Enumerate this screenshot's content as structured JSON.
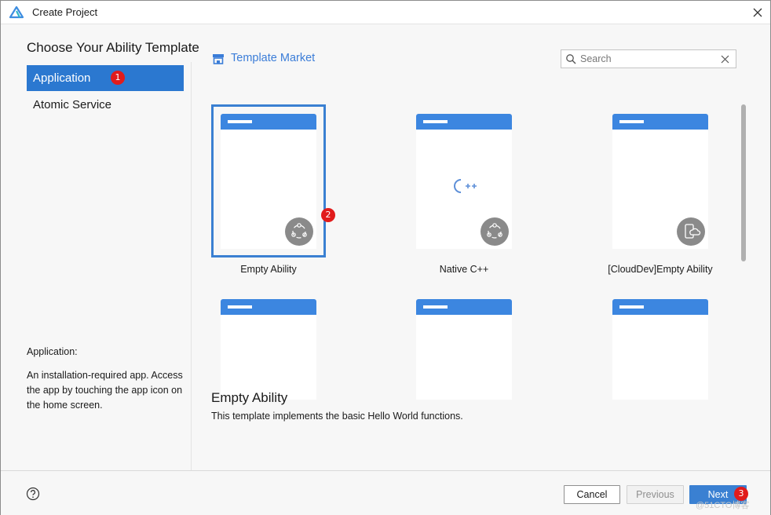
{
  "window": {
    "title": "Create Project"
  },
  "heading": "Choose Your Ability Template",
  "sidebar": {
    "items": [
      {
        "label": "Application",
        "active": true
      },
      {
        "label": "Atomic Service",
        "active": false
      }
    ],
    "description_title": "Application:",
    "description_text": "An installation-required app. Access the app by touching the app icon on the home screen."
  },
  "badges": {
    "application": "1",
    "selected_card": "2",
    "next": "3"
  },
  "market": {
    "label": "Template Market",
    "search_placeholder": "Search"
  },
  "templates": [
    {
      "label": "Empty Ability",
      "icon": "ability-icon",
      "selected": true
    },
    {
      "label": "Native C++",
      "icon": "cpp-icon",
      "selected": false
    },
    {
      "label": "[CloudDev]Empty Ability",
      "icon": "cloud-device-icon",
      "selected": false
    },
    {
      "label": "",
      "icon": "",
      "selected": false
    },
    {
      "label": "",
      "icon": "",
      "selected": false
    },
    {
      "label": "",
      "icon": "",
      "selected": false
    }
  ],
  "detail": {
    "title": "Empty Ability",
    "text": "This template implements the basic Hello World functions."
  },
  "footer": {
    "cancel_label": "Cancel",
    "previous_label": "Previous",
    "next_label": "Next",
    "watermark": "@51CTO博客"
  },
  "colors": {
    "accent": "#2b78d0",
    "card_header": "#3c86e0",
    "badge": "#e11b1b",
    "market_text": "#3b7dd8"
  }
}
